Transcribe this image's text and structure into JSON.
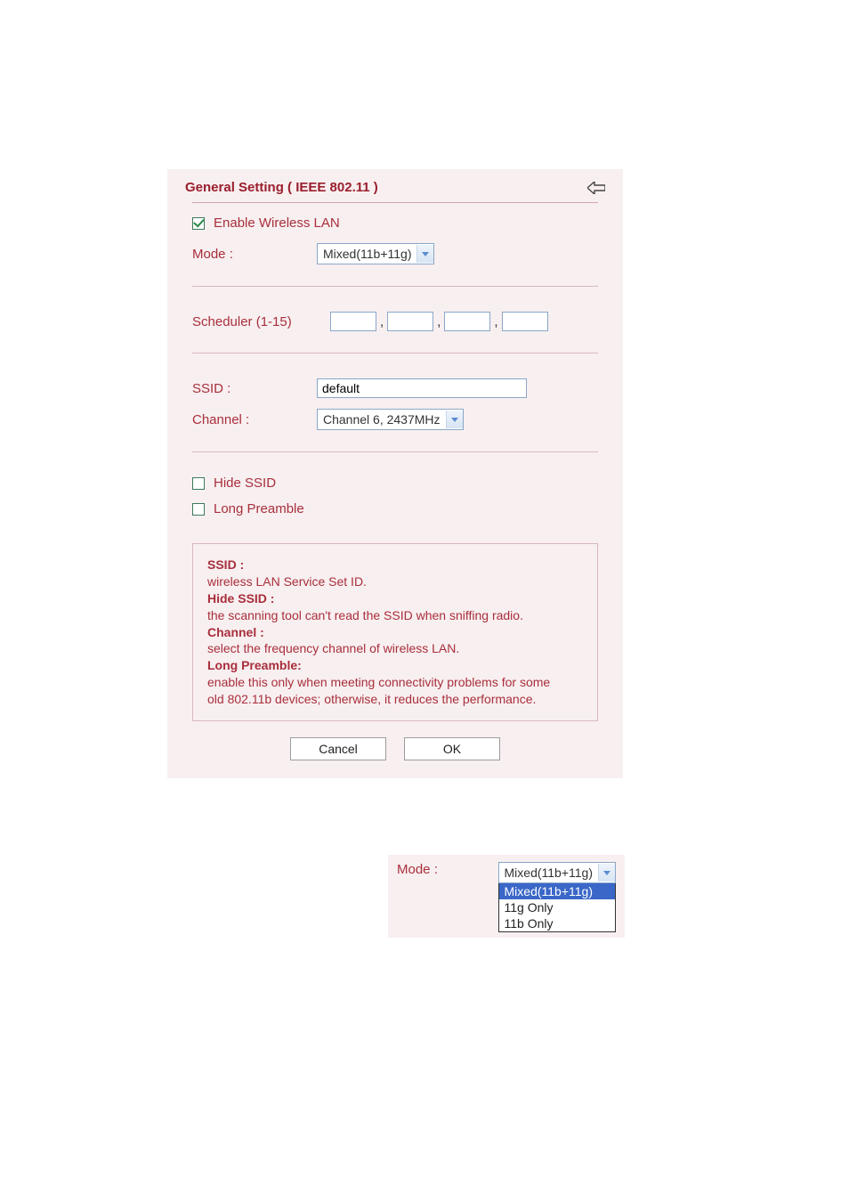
{
  "title": "General Setting ( IEEE 802.11 )",
  "enable_wlan": {
    "label": "Enable Wireless LAN",
    "checked": true
  },
  "mode": {
    "label": "Mode :",
    "value": "Mixed(11b+11g)"
  },
  "scheduler": {
    "label": "Scheduler (1-15)",
    "v1": "",
    "v2": "",
    "v3": "",
    "v4": ""
  },
  "ssid": {
    "label": "SSID :",
    "value": "default"
  },
  "channel": {
    "label": "Channel :",
    "value": "Channel 6, 2437MHz"
  },
  "hide_ssid": {
    "label": "Hide SSID",
    "checked": false
  },
  "long_preamble": {
    "label": "Long Preamble",
    "checked": false
  },
  "desc": {
    "ssid_term": "SSID :",
    "ssid_text": "wireless LAN Service Set ID.",
    "hide_term": "Hide SSID :",
    "hide_text": "the scanning tool can't read the SSID when sniffing radio.",
    "channel_term": "Channel :",
    "channel_text": "select the frequency channel of wireless LAN.",
    "lp_term": "Long Preamble:",
    "lp_text1": "enable this only when meeting connectivity problems for some",
    "lp_text2": "old 802.11b devices; otherwise, it reduces the performance."
  },
  "buttons": {
    "cancel": "Cancel",
    "ok": "OK"
  },
  "mode_open": {
    "label": "Mode :",
    "value": "Mixed(11b+11g)",
    "options": [
      "Mixed(11b+11g)",
      "11g Only",
      "11b Only"
    ],
    "selected_index": 0
  }
}
